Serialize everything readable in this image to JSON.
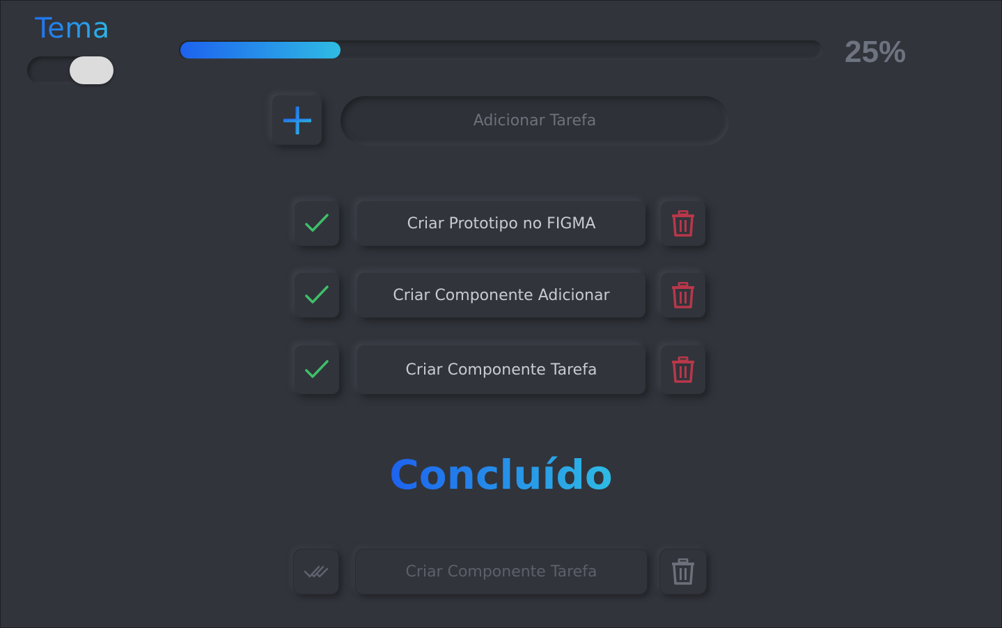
{
  "theme": {
    "title": "Tema",
    "toggle_on": true
  },
  "progress": {
    "value_percent": 25,
    "label": "25%"
  },
  "add_task": {
    "placeholder": "Adicionar Tarefa",
    "button_icon": "plus-icon"
  },
  "tasks": [
    {
      "label": "Criar Prototipo no FIGMA",
      "check_icon": "check-icon",
      "delete_icon": "trash-icon"
    },
    {
      "label": "Criar Componente Adicionar",
      "check_icon": "check-icon",
      "delete_icon": "trash-icon"
    },
    {
      "label": "Criar Componente Tarefa",
      "check_icon": "check-icon",
      "delete_icon": "trash-icon"
    }
  ],
  "completed_section": {
    "title": "Concluído",
    "tasks": [
      {
        "label": "Criar Componente Tarefa",
        "check_icon": "double-check-icon",
        "delete_icon": "trash-icon"
      }
    ]
  },
  "colors": {
    "background": "#31343b",
    "accent_start": "#1d62ef",
    "accent_end": "#2fbbe4",
    "check_green": "#3fbf6a",
    "delete_red": "#b8374a",
    "muted": "#6e7380"
  }
}
